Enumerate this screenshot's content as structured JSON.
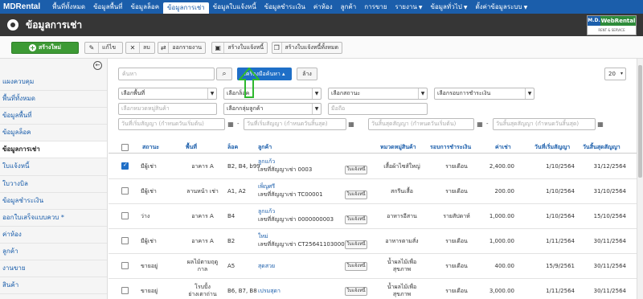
{
  "topnav": {
    "brand": "MDRental",
    "items": [
      {
        "label": "พื้นที่ทั้งหมด",
        "caret": false
      },
      {
        "label": "ข้อมูลพื้นที่",
        "caret": false
      },
      {
        "label": "ข้อมูลล็อค",
        "caret": false
      },
      {
        "label": "ข้อมูลการเช่า",
        "caret": false,
        "active": true
      },
      {
        "label": "ข้อมูลใบแจ้งหนี้",
        "caret": false
      },
      {
        "label": "ข้อมูลชำระเงิน",
        "caret": false
      },
      {
        "label": "ค่าห้อง",
        "caret": false
      },
      {
        "label": "ลูกค้า",
        "caret": false
      },
      {
        "label": "การขาย",
        "caret": false
      },
      {
        "label": "รายงาน",
        "caret": true
      },
      {
        "label": "ข้อมูลทั่วไป",
        "caret": true
      },
      {
        "label": "ตั้งค่าข้อมูลระบบ",
        "caret": true
      }
    ]
  },
  "header": {
    "title": "ข้อมูลการเช่า",
    "logo": {
      "md": "M.D.",
      "name": "WebRental",
      "sub": "RENT & SERVICE"
    }
  },
  "toolbar": {
    "new_label": "สร้างใหม่",
    "edit_label": "แก้ไข",
    "delete_label": "ลบ",
    "export_label": "ออกรายงาน",
    "create_invoice_label": "สร้างใบแจ้งหนี้",
    "create_all_invoices_label": "สร้างใบแจ้งหนี้ทั้งหมด"
  },
  "sidebar": {
    "items": [
      {
        "label": "แผงควบคุม"
      },
      {
        "label": "พื้นที่ทั้งหมด"
      },
      {
        "label": "ข้อมูลพื้นที่"
      },
      {
        "label": "ข้อมูลล็อค"
      },
      {
        "label": "ข้อมูลการเช่า",
        "active": true
      },
      {
        "label": "ใบแจ้งหนี้"
      },
      {
        "label": "ใบวางบิล"
      },
      {
        "label": "ข้อมูลชำระเงิน"
      },
      {
        "label": "ออกใบเสร็จแบบควบ *"
      },
      {
        "label": "ค่าห้อง"
      },
      {
        "label": "ลูกค้า"
      },
      {
        "label": "งานขาย"
      },
      {
        "label": "สินค้า"
      }
    ]
  },
  "search": {
    "placeholder": "ค้นหา",
    "tools_label": "เครื่องมือค้นหา ▴",
    "clear_label": "ล้าง",
    "limit_value": "20"
  },
  "filters": {
    "area": "เลือกพื้นที่",
    "lock": "เลือกล็อค",
    "status": "เลือกสถานะ",
    "payment_cycle": "เลือกรอบการชำระเงิน",
    "product_category": "เลือกหมวดหมู่สินค้า",
    "customer_group": "เลือกกลุ่มลูกค้า",
    "mobile": "มือถือ",
    "start_from": "วันที่เริ่มสัญญา (กำหนดวันเริ่มต้น)",
    "start_to": "วันที่เริ่มสัญญา (กำหนดวันสิ้นสุด)",
    "end_from": "วันสิ้นสุดสัญญา (กำหนดวันเริ่มต้น)",
    "end_to": "วันสิ้นสุดสัญญา (กำหนดวันสิ้นสุด)"
  },
  "table": {
    "headers": {
      "status": "สถานะ",
      "area": "พื้นที่",
      "lock": "ล็อค",
      "customer": "ลูกค้า",
      "category": "หมวดหมู่สินค้า",
      "cycle": "รอบการชำระเงิน",
      "rent": "ค่าเช่า",
      "start": "วันที่เริ่มสัญญา",
      "end": "วันสิ้นสุดสัญญา"
    },
    "invoice_btn_label": "ใบแจ้งหนี้",
    "rows": [
      {
        "checked": true,
        "status": "มีผู้เช่า",
        "area": "อาคาร A",
        "area2": "",
        "lock": "B2, B4, b99",
        "customer": "ลูกแก้ว",
        "contract": "เลขที่สัญญาเช่า 0003",
        "category": "เสื้อผ้าไซส์ใหญ่",
        "category2": "",
        "cycle": "รายเดือน",
        "rent": "2,400.00",
        "start": "1/10/2564",
        "end": "31/12/2564"
      },
      {
        "checked": false,
        "status": "มีผู้เช่า",
        "area": "ลานหน้า เช่า",
        "area2": "",
        "lock": "A1, A2",
        "customer": "เพ็ญศรี",
        "contract": "เลขที่สัญญาเช่า TC00001",
        "category": "สกรีนเสื้อ",
        "category2": "",
        "cycle": "รายเดือน",
        "rent": "200.00",
        "start": "1/10/2564",
        "end": "31/10/2564"
      },
      {
        "checked": false,
        "status": "ว่าง",
        "area": "อาคาร A",
        "area2": "",
        "lock": "B4",
        "customer": "ลูกแก้ว",
        "contract": "เลขที่สัญญาเช่า 0000000003",
        "category": "อาหารอีสาน",
        "category2": "",
        "cycle": "รายสัปดาห์",
        "rent": "1,000.00",
        "start": "1/10/2564",
        "end": "15/10/2564"
      },
      {
        "checked": false,
        "status": "มีผู้เช่า",
        "area": "อาคาร A",
        "area2": "",
        "lock": "B2",
        "customer": "ใหม่",
        "contract": "เลขที่สัญญาเช่า CT2564110300009",
        "category": "อาหารตามสั่ง",
        "category2": "",
        "cycle": "รายเดือน",
        "rent": "1,000.00",
        "start": "1/11/2564",
        "end": "30/11/2564"
      },
      {
        "checked": false,
        "status": "ขายอยู่",
        "area": "ผลไม้ตามฤดู",
        "area2": "กาล",
        "lock": "A5",
        "customer": "สุดสวย",
        "contract": "",
        "category": "น้ำผลไม้เพื่อ",
        "category2": "สุขภาพ",
        "cycle": "รายเดือน",
        "rent": "400.00",
        "start": "15/9/2561",
        "end": "30/11/2564"
      },
      {
        "checked": false,
        "status": "ขายอยู่",
        "area": "โรบปั้ง",
        "area2": "ย่างเตาถ่าน",
        "lock": "B6, B7, B8",
        "customer": "เปรมสุดา",
        "contract": "",
        "category": "น้ำผลไม้เพื่อ",
        "category2": "สุขภาพ",
        "cycle": "รายเดือน",
        "rent": "3,000.00",
        "start": "1/11/2564",
        "end": "30/11/2564"
      }
    ]
  },
  "colors": {
    "nav": "#1b5eab",
    "header": "#363636",
    "new_button": "#3d9a35",
    "annotation_arrow": "#2eb82e",
    "link": "#1b5eab"
  }
}
